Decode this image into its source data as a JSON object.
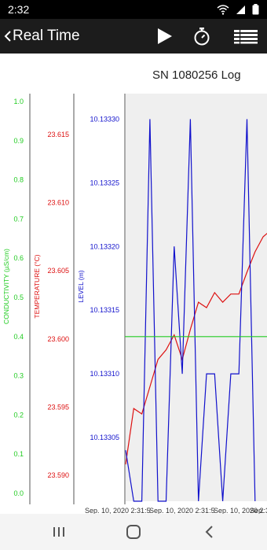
{
  "status_bar": {
    "time": "2:32",
    "icons": [
      "wifi-icon",
      "signal-icon",
      "battery-icon"
    ]
  },
  "app_bar": {
    "title": "Real Time",
    "actions": [
      "play-icon",
      "stopwatch-icon",
      "list-view-icon"
    ]
  },
  "nav_bar": {
    "buttons": [
      "recent-apps-icon",
      "home-icon",
      "back-icon"
    ]
  },
  "colors": {
    "conductivity": "#22cc22",
    "temperature": "#dd1111",
    "level": "#1111cc",
    "threshold": "#22cc22",
    "plot_background": "#efefef"
  },
  "chart_data": {
    "type": "line",
    "title": "SN 1080256 Log",
    "x_axis": {
      "tick_labels": [
        "Sep. 10, 2020 2:31:5",
        "Sep. 10, 2020 2:31:5",
        "Sep. 10, 2020 2:31:5",
        "Sep. 10, 2020 2:31:5"
      ],
      "point_count": 34
    },
    "y_axes": [
      {
        "key": "conductivity",
        "label": "CONDUCTIVITY (µS/cm)",
        "ticks": [
          "0.0",
          "0.1",
          "0.2",
          "0.3",
          "0.4",
          "0.5",
          "0.6",
          "0.7",
          "0.8",
          "0.9",
          "1.0"
        ],
        "range": [
          -0.02,
          1.02
        ]
      },
      {
        "key": "temperature",
        "label": "TEMPERATURE (°C)",
        "ticks": [
          "23.590",
          "23.595",
          "23.600",
          "23.605",
          "23.610",
          "23.615"
        ],
        "range": [
          23.5881,
          23.618
        ]
      },
      {
        "key": "level",
        "label": "LEVEL (m)",
        "ticks": [
          "10.13305",
          "10.13310",
          "10.13315",
          "10.13320",
          "10.13325",
          "10.13330"
        ],
        "range": [
          10.133,
          10.13332
        ]
      }
    ],
    "series": [
      {
        "name": "TEMPERATURE (°C)",
        "axis": "temperature",
        "values": [
          23.5908,
          23.5949,
          23.5945,
          23.5965,
          23.5985,
          23.5992,
          23.6003,
          23.5985,
          23.6007,
          23.6027,
          23.6023,
          23.6034,
          23.6027,
          23.6033,
          23.6033,
          23.6049,
          23.6064,
          23.6075,
          23.608,
          23.6077
        ]
      },
      {
        "name": "LEVEL (m)",
        "axis": "level",
        "values": [
          10.13304,
          10.133,
          10.133,
          10.1333,
          10.133,
          10.133,
          10.1332,
          10.1331,
          10.1333,
          10.133,
          10.1331,
          10.1331,
          10.133,
          10.1331,
          10.1331,
          10.1333,
          10.133
        ]
      },
      {
        "name": "CONDUCTIVITY (µS/cm)",
        "axis": "conductivity",
        "values": [
          0.4,
          0.4
        ]
      }
    ],
    "grid": false,
    "legend": "none"
  }
}
